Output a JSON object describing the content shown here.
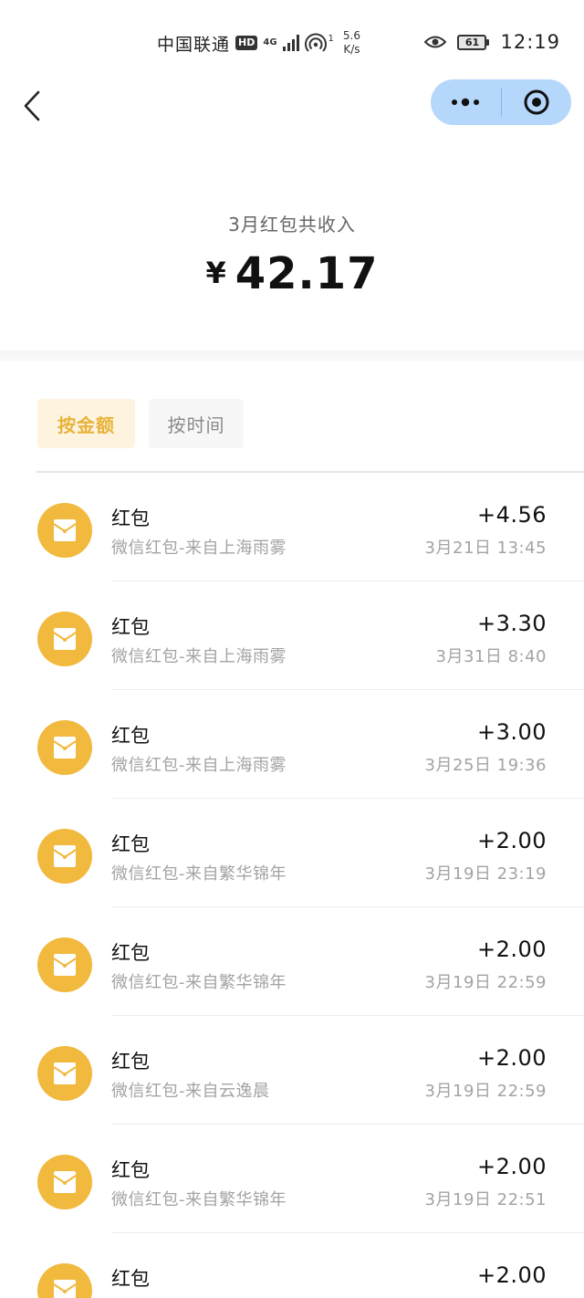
{
  "status_bar": {
    "carrier": "中国联通",
    "hd": "HD",
    "network": "4G",
    "hotspot_count": "1",
    "speed_value": "5.6",
    "speed_unit": "K/s",
    "battery": "61",
    "time": "12:19",
    "icons": [
      "signal-icon",
      "hotspot-icon",
      "eye-icon",
      "battery-icon"
    ]
  },
  "nav": {
    "back_icon": "chevron-left-icon",
    "capsule_icons": [
      "more-icon",
      "target-icon"
    ],
    "capsule_color": "#b5d7fb"
  },
  "summary": {
    "label": "3月红包共收入",
    "currency": "¥",
    "amount": "42.17"
  },
  "tabs": [
    {
      "label": "按金额",
      "active": true
    },
    {
      "label": "按时间",
      "active": false
    }
  ],
  "colors": {
    "accent": "#f1b93d",
    "tab_active_text": "#e8b33a",
    "tab_active_bg": "#fdf3df"
  },
  "records": [
    {
      "title": "红包",
      "source": "微信红包-来自上海雨雾",
      "amount": "+4.56",
      "time": "3月21日 13:45"
    },
    {
      "title": "红包",
      "source": "微信红包-来自上海雨雾",
      "amount": "+3.30",
      "time": "3月31日 8:40"
    },
    {
      "title": "红包",
      "source": "微信红包-来自上海雨雾",
      "amount": "+3.00",
      "time": "3月25日 19:36"
    },
    {
      "title": "红包",
      "source": "微信红包-来自繁华锦年",
      "amount": "+2.00",
      "time": "3月19日 23:19"
    },
    {
      "title": "红包",
      "source": "微信红包-来自繁华锦年",
      "amount": "+2.00",
      "time": "3月19日 22:59"
    },
    {
      "title": "红包",
      "source": "微信红包-来自云逸晨",
      "amount": "+2.00",
      "time": "3月19日 22:59"
    },
    {
      "title": "红包",
      "source": "微信红包-来自繁华锦年",
      "amount": "+2.00",
      "time": "3月19日 22:51"
    },
    {
      "title": "红包",
      "source": "",
      "amount": "+2.00",
      "time": ""
    }
  ]
}
